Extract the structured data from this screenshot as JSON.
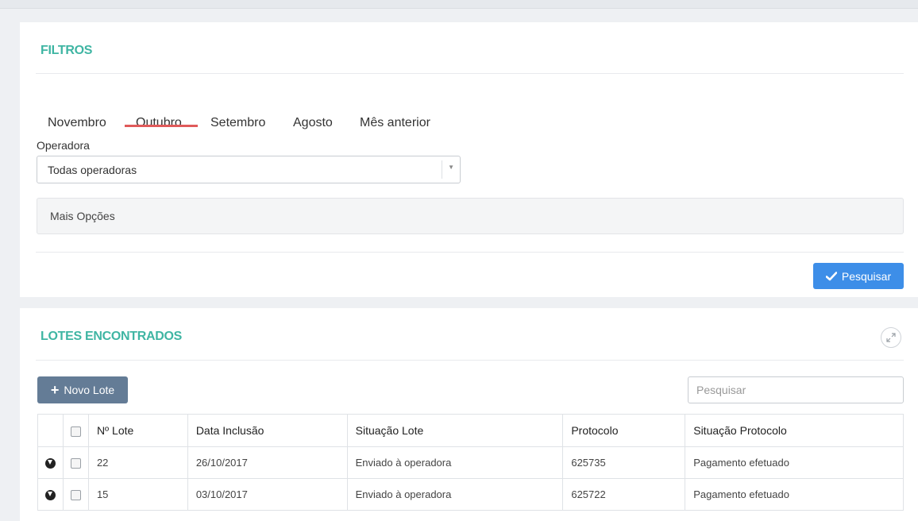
{
  "filtros": {
    "title": "FILTROS",
    "tabs": [
      {
        "label": "Novembro"
      },
      {
        "label": "Outubro",
        "active": true
      },
      {
        "label": "Setembro"
      },
      {
        "label": "Agosto"
      },
      {
        "label": "Mês anterior"
      }
    ],
    "operadora_label": "Operadora",
    "operadora_value": "Todas operadoras",
    "mais_opcoes": "Mais Opções",
    "search_button": "Pesquisar"
  },
  "lotes": {
    "title": "LOTES ENCONTRADOS",
    "new_button": "Novo Lote",
    "search_placeholder": "Pesquisar",
    "columns": [
      "Nº Lote",
      "Data Inclusão",
      "Situação Lote",
      "Protocolo",
      "Situação Protocolo"
    ],
    "rows": [
      {
        "lote": "22",
        "data": "26/10/2017",
        "situacao": "Enviado à operadora",
        "protocolo": "625735",
        "situacao_protocolo": "Pagamento efetuado"
      },
      {
        "lote": "15",
        "data": "03/10/2017",
        "situacao": "Enviado à operadora",
        "protocolo": "625722",
        "situacao_protocolo": "Pagamento efetuado"
      }
    ]
  },
  "colors": {
    "accent": "#3fb5a3",
    "tab_underline": "#e05a5a",
    "primary_button": "#3d8ee8",
    "secondary_button": "#647c96"
  },
  "icons": {
    "search_button_icon": "check-icon",
    "new_button_icon": "plus-icon",
    "expand": "expand-icon",
    "row_toggle": "circle-chevron-down-icon",
    "select_caret": "caret-down-icon"
  }
}
